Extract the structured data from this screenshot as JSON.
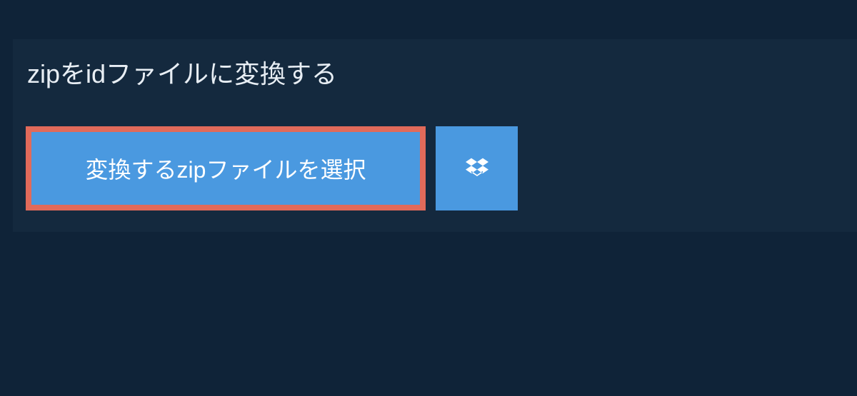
{
  "title": "zipをidファイルに変換する",
  "buttons": {
    "select_file_label": "変換するzipファイルを選択"
  },
  "colors": {
    "page_bg": "#0f2338",
    "panel_bg": "#14293e",
    "button_bg": "#4a99e0",
    "button_border": "#e16a5a",
    "text_light": "#e8eef4",
    "text_white": "#ffffff"
  }
}
